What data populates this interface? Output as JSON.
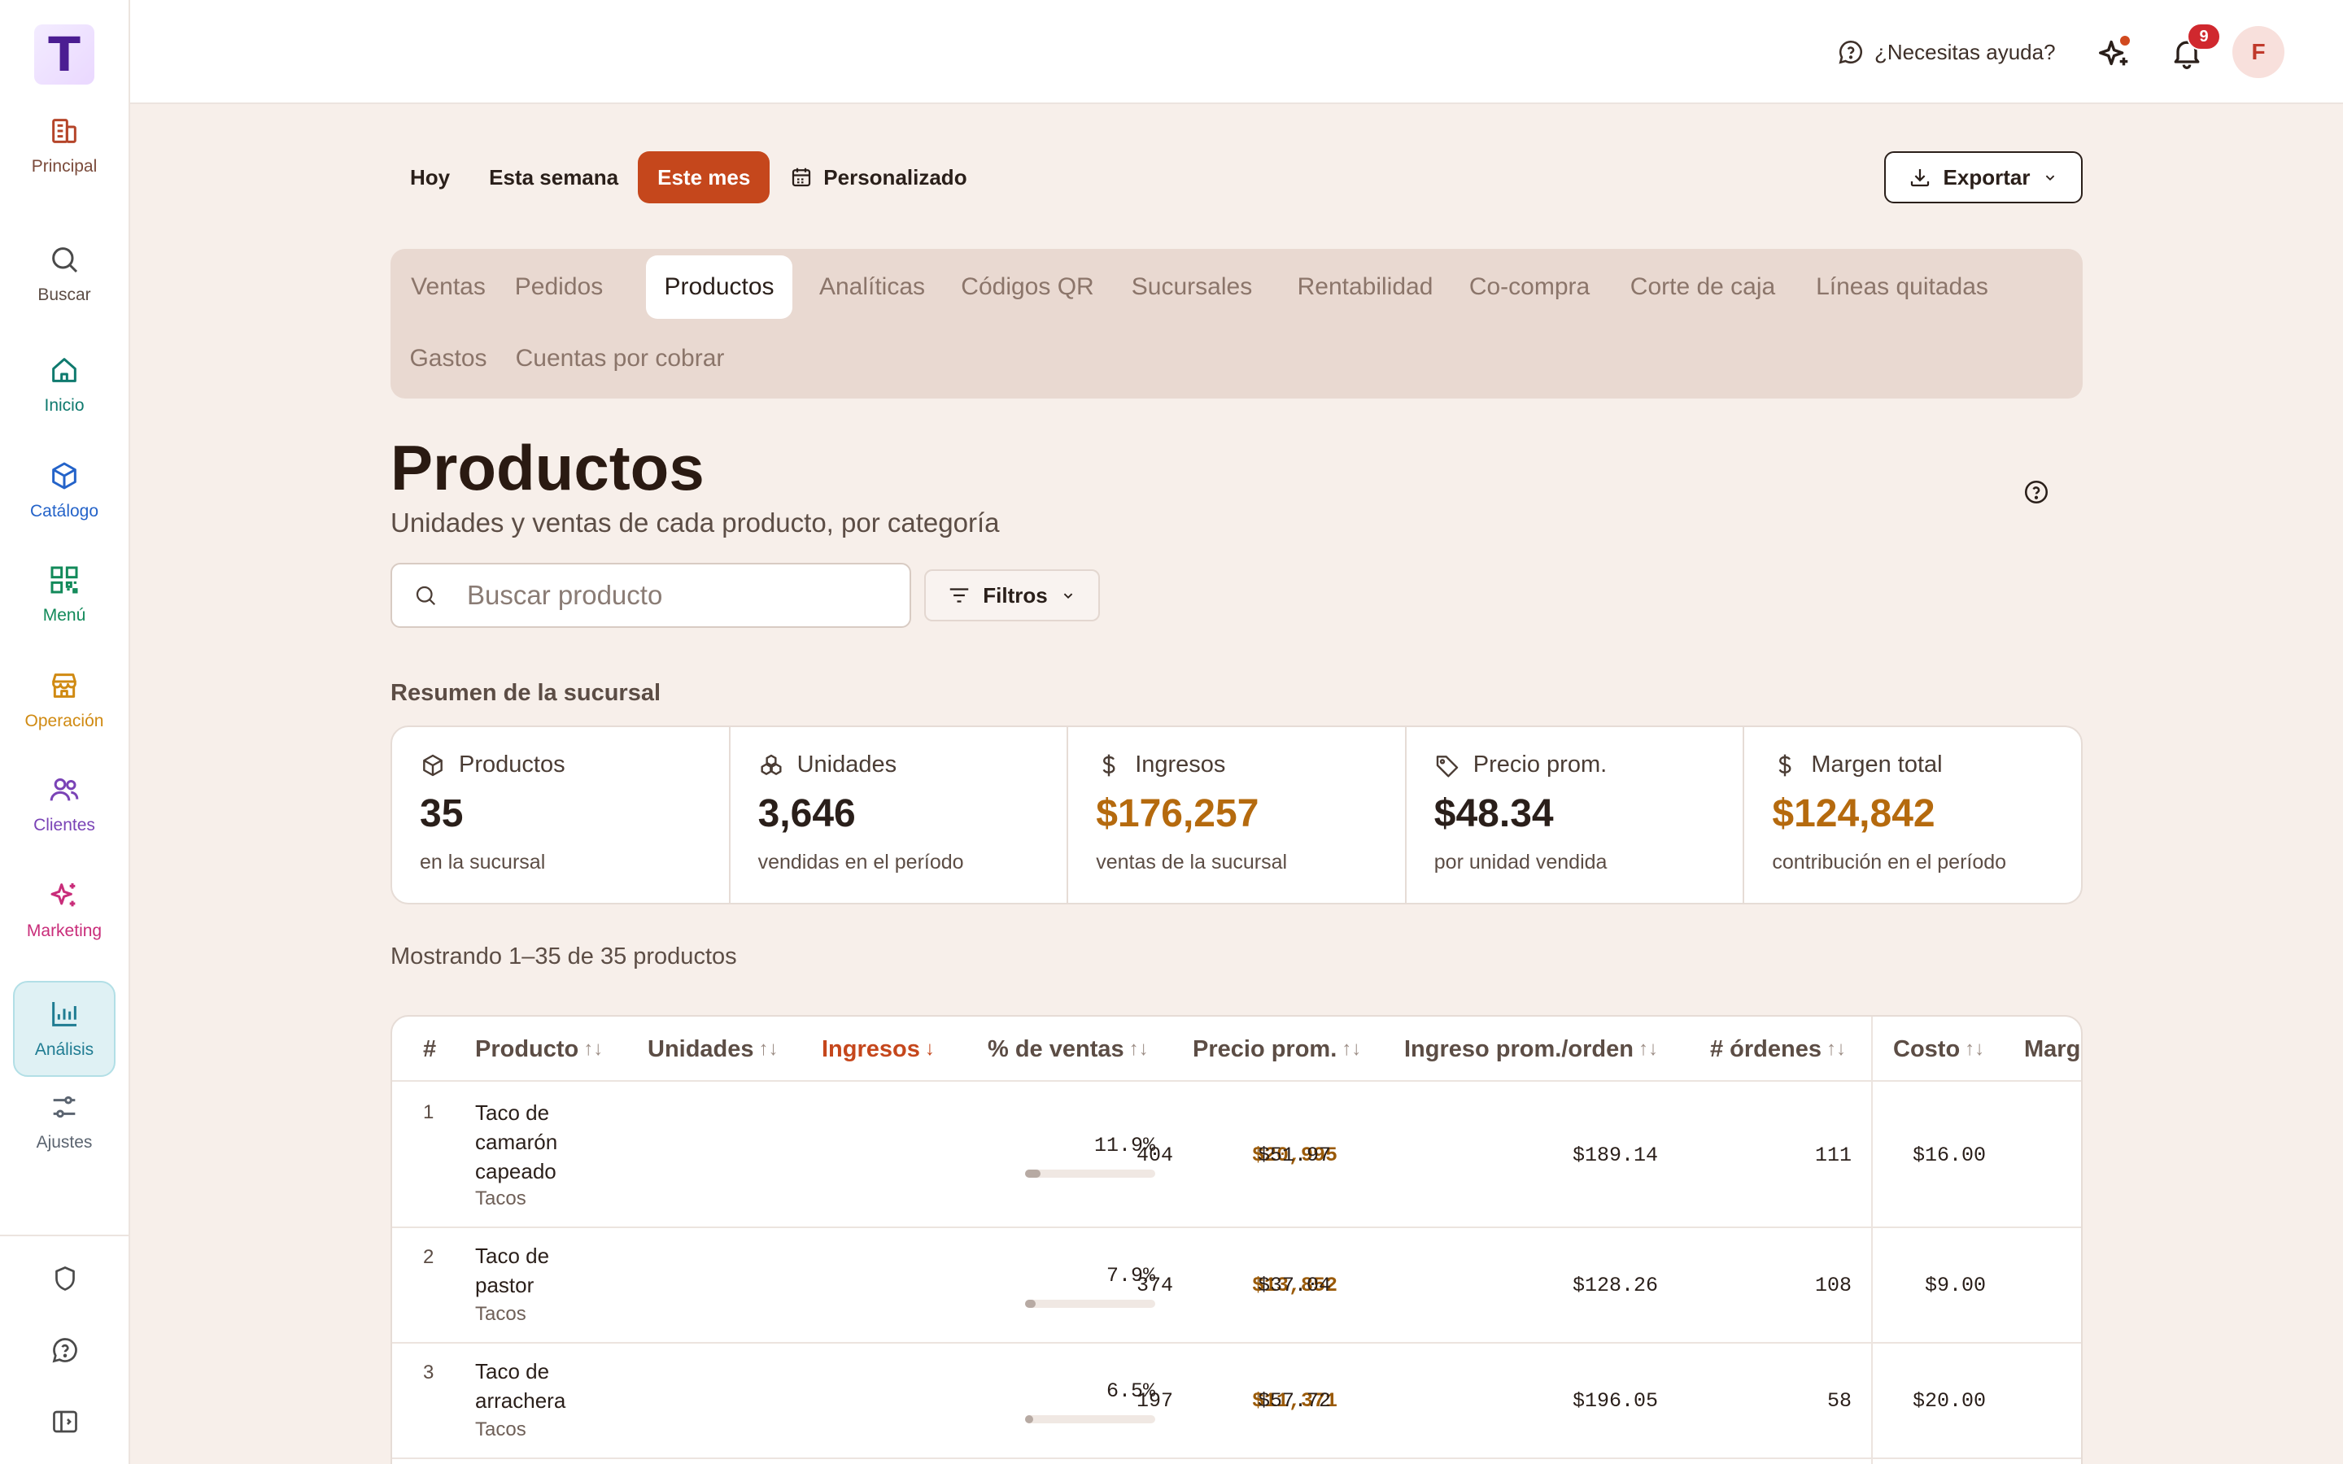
{
  "sidebar": {
    "logo_letter": "T",
    "items": [
      {
        "label": "Principal",
        "icon": "building-icon",
        "color": "#b5452a"
      },
      {
        "label": "Buscar",
        "icon": "search-icon",
        "color": "#4a4a4a"
      },
      {
        "label": "Inicio",
        "icon": "home-icon",
        "color": "#0f7a6e"
      },
      {
        "label": "Catálogo",
        "icon": "box-icon",
        "color": "#2463c9"
      },
      {
        "label": "Menú",
        "icon": "qr-icon",
        "color": "#128a5a"
      },
      {
        "label": "Operación",
        "icon": "store-icon",
        "color": "#d08a12"
      },
      {
        "label": "Clientes",
        "icon": "users-icon",
        "color": "#7a43b6"
      },
      {
        "label": "Marketing",
        "icon": "sparkles-icon",
        "color": "#c92d7a"
      },
      {
        "label": "Análisis",
        "icon": "bar-chart-icon",
        "color": "#1f7c92"
      },
      {
        "label": "Ajustes",
        "icon": "sliders-icon",
        "color": "#5b6470"
      }
    ]
  },
  "topbar": {
    "help_label": "¿Necesitas ayuda?",
    "notifications_count": "9",
    "avatar_initial": "F"
  },
  "period": {
    "options": [
      "Hoy",
      "Esta semana",
      "Este mes",
      "Personalizado"
    ],
    "selected": "Este mes"
  },
  "export_label": "Exportar",
  "tabs": {
    "items": [
      "Ventas",
      "Pedidos",
      "Productos",
      "Analíticas",
      "Códigos QR",
      "Sucursales",
      "Rentabilidad",
      "Co-compra",
      "Corte de caja",
      "Líneas quitadas",
      "Gastos",
      "Cuentas por cobrar"
    ],
    "selected": "Productos"
  },
  "page": {
    "title": "Productos",
    "subtitle": "Unidades y ventas de cada producto, por categoría"
  },
  "search": {
    "placeholder": "Buscar producto",
    "value": ""
  },
  "filters_label": "Filtros",
  "summary": {
    "label": "Resumen de la sucursal",
    "stats": [
      {
        "label": "Productos",
        "value": "35",
        "note": "en la sucursal",
        "icon": "box-icon"
      },
      {
        "label": "Unidades",
        "value": "3,646",
        "note": "vendidas en el período",
        "icon": "layers-icon"
      },
      {
        "label": "Ingresos",
        "value": "$176,257",
        "note": "ventas de la sucursal",
        "icon": "dollar-icon"
      },
      {
        "label": "Precio prom.",
        "value": "$48.34",
        "note": "por unidad vendida",
        "icon": "tag-icon"
      },
      {
        "label": "Margen total",
        "value": "$124,842",
        "note": "contribución en el período",
        "icon": "dollar-icon"
      }
    ]
  },
  "showing": "Mostrando 1–35 de 35 productos",
  "table": {
    "columns": [
      "#",
      "Producto",
      "Unidades",
      "Ingresos",
      "% de ventas",
      "Precio prom.",
      "Ingreso prom./orden",
      "# órdenes",
      "Costo",
      "Margen"
    ],
    "sorted_column": "Ingresos",
    "rows": [
      {
        "idx": "1",
        "name": "Taco de camarón capeado",
        "category": "Tacos",
        "units": "404",
        "revenue": "$20,995",
        "pct": "11.9%",
        "pct_value": 11.9,
        "avg_price": "$51.97",
        "avg_order": "$189.14",
        "orders": "111",
        "cost": "$16.00"
      },
      {
        "idx": "2",
        "name": "Taco de pastor",
        "category": "Tacos",
        "units": "374",
        "revenue": "$13,852",
        "pct": "7.9%",
        "pct_value": 7.9,
        "avg_price": "$37.04",
        "avg_order": "$128.26",
        "orders": "108",
        "cost": "$9.00"
      },
      {
        "idx": "3",
        "name": "Taco de arrachera",
        "category": "Tacos",
        "units": "197",
        "revenue": "$11,371",
        "pct": "6.5%",
        "pct_value": 6.5,
        "avg_price": "$57.72",
        "avg_order": "$196.05",
        "orders": "58",
        "cost": "$20.00"
      }
    ]
  }
}
